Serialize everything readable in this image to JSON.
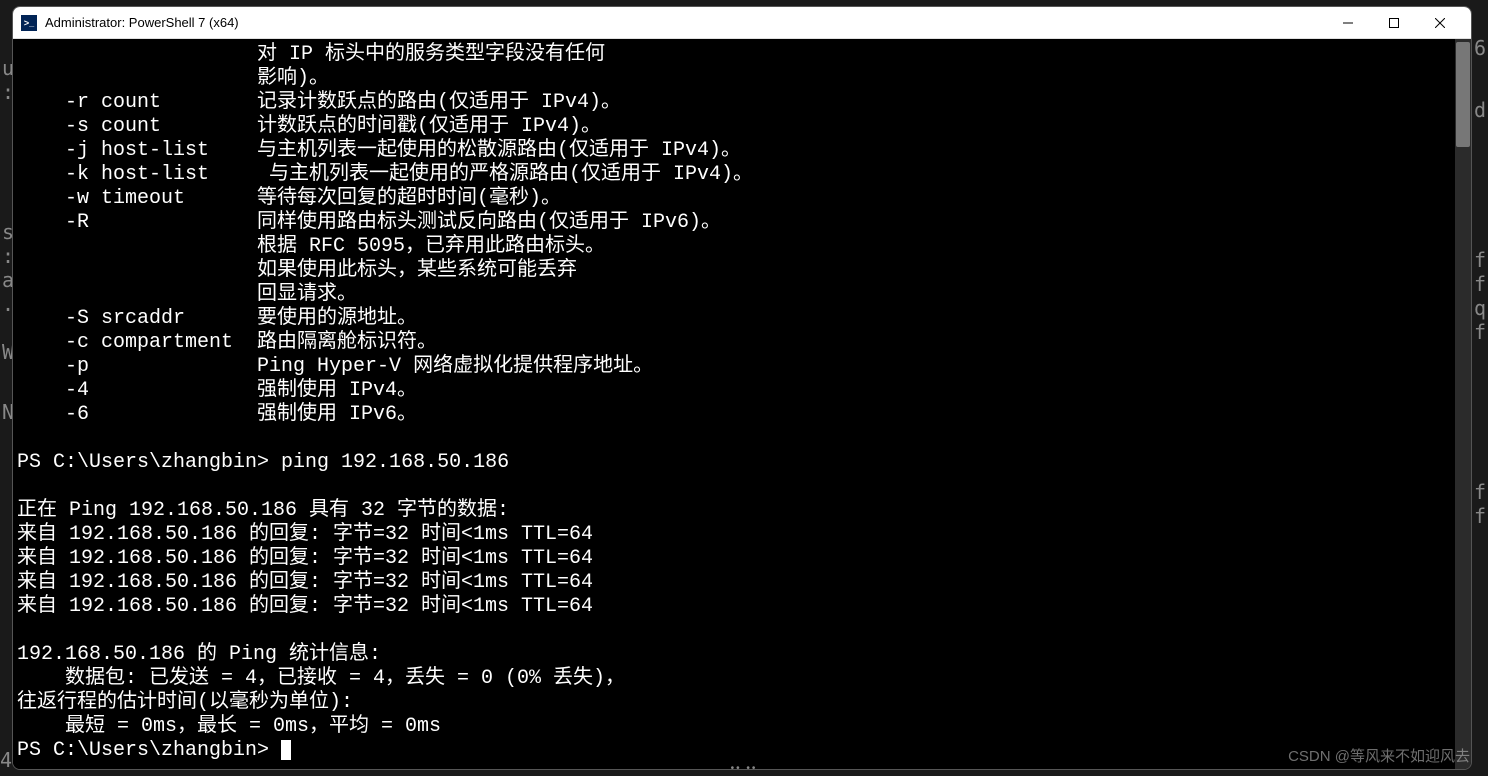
{
  "window": {
    "title": "Administrator: PowerShell 7 (x64)"
  },
  "bg_chars": {
    "c0": "u",
    "c1": ":",
    "c2": "s",
    "c3": ":",
    "c4": "a",
    "c5": ".",
    "c6": "W",
    "c7": "N",
    "c8": "4",
    "c9": "6",
    "c10": "d",
    "c11": "f",
    "c12": "f",
    "c13": "q",
    "c14": "f",
    "c15": "f",
    "c16": "f"
  },
  "terminal": {
    "lines": [
      "                    对 IP 标头中的服务类型字段没有任何",
      "                    影响)。",
      "    -r count        记录计数跃点的路由(仅适用于 IPv4)。",
      "    -s count        计数跃点的时间戳(仅适用于 IPv4)。",
      "    -j host-list    与主机列表一起使用的松散源路由(仅适用于 IPv4)。",
      "    -k host-list     与主机列表一起使用的严格源路由(仅适用于 IPv4)。",
      "    -w timeout      等待每次回复的超时时间(毫秒)。",
      "    -R              同样使用路由标头测试反向路由(仅适用于 IPv6)。",
      "                    根据 RFC 5095，已弃用此路由标头。",
      "                    如果使用此标头，某些系统可能丢弃",
      "                    回显请求。",
      "    -S srcaddr      要使用的源地址。",
      "    -c compartment  路由隔离舱标识符。",
      "    -p              Ping Hyper-V 网络虚拟化提供程序地址。",
      "    -4              强制使用 IPv4。",
      "    -6              强制使用 IPv6。",
      "",
      "PS C:\\Users\\zhangbin> ping 192.168.50.186",
      "",
      "正在 Ping 192.168.50.186 具有 32 字节的数据:",
      "来自 192.168.50.186 的回复: 字节=32 时间<1ms TTL=64",
      "来自 192.168.50.186 的回复: 字节=32 时间<1ms TTL=64",
      "来自 192.168.50.186 的回复: 字节=32 时间<1ms TTL=64",
      "来自 192.168.50.186 的回复: 字节=32 时间<1ms TTL=64",
      "",
      "192.168.50.186 的 Ping 统计信息:",
      "    数据包: 已发送 = 4，已接收 = 4，丢失 = 0 (0% 丢失)，",
      "往返行程的估计时间(以毫秒为单位):",
      "    最短 = 0ms，最长 = 0ms，平均 = 0ms"
    ],
    "prompt": "PS C:\\Users\\zhangbin> "
  },
  "watermark": "CSDN @等风来不如迎风去"
}
